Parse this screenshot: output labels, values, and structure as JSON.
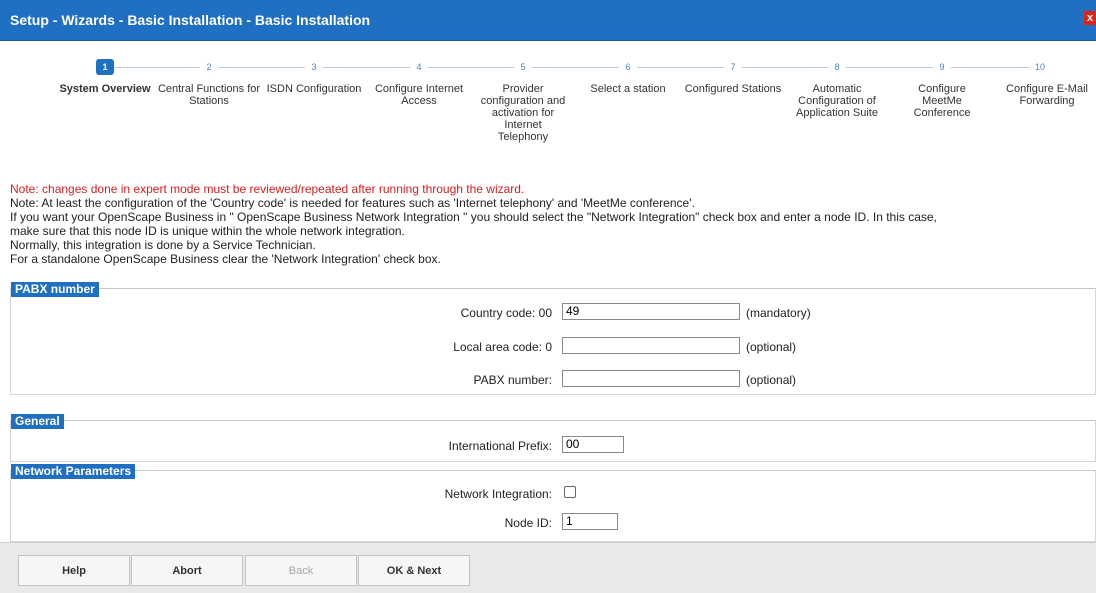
{
  "window": {
    "title": "Setup - Wizards - Basic Installation - Basic Installation",
    "close_glyph": "x"
  },
  "steps": [
    {
      "num": "1",
      "label": "System Overview",
      "active": true
    },
    {
      "num": "2",
      "label": "Central Functions for Stations"
    },
    {
      "num": "3",
      "label": "ISDN Configuration"
    },
    {
      "num": "4",
      "label": "Configure Internet Access"
    },
    {
      "num": "5",
      "label": "Provider configuration and activation for Internet Telephony"
    },
    {
      "num": "6",
      "label": "Select a station"
    },
    {
      "num": "7",
      "label": "Configured Stations"
    },
    {
      "num": "8",
      "label": "Automatic Configuration of Application Suite"
    },
    {
      "num": "9",
      "label": "Configure MeetMe Conference"
    },
    {
      "num": "10",
      "label": "Configure E-Mail Forwarding"
    }
  ],
  "notes": {
    "warning": "Note: changes done in expert mode must be reviewed/repeated after running through the wizard.",
    "line1": "Note: At least the configuration of the 'Country code' is needed for features such as 'Internet telephony' and 'MeetMe conference'.",
    "line2": "If you want your OpenScape Business in \" OpenScape Business Network Integration \" you should select the \"Network Integration\" check box and enter a node ID. In this case,",
    "line3": "make sure that this node ID is unique within the whole network integration.",
    "line4": "Normally, this integration is done by a Service Technician.",
    "line5": "For a standalone OpenScape Business clear the 'Network Integration' check box."
  },
  "pabx": {
    "heading": "PABX number",
    "country_label": "Country code:  00",
    "country_value": "49",
    "country_hint": "(mandatory)",
    "local_label": "Local area code:  0",
    "local_value": "",
    "local_hint": "(optional)",
    "number_label": "PABX number:",
    "number_value": "",
    "number_hint": "(optional)"
  },
  "general": {
    "heading": "General",
    "prefix_label": "International Prefix:",
    "prefix_value": "00"
  },
  "network": {
    "heading": "Network Parameters",
    "integration_label": "Network Integration:",
    "integration_checked": false,
    "node_label": "Node ID:",
    "node_value": "1"
  },
  "footer": {
    "help": "Help",
    "abort": "Abort",
    "back": "Back",
    "ok_next": "OK & Next"
  }
}
